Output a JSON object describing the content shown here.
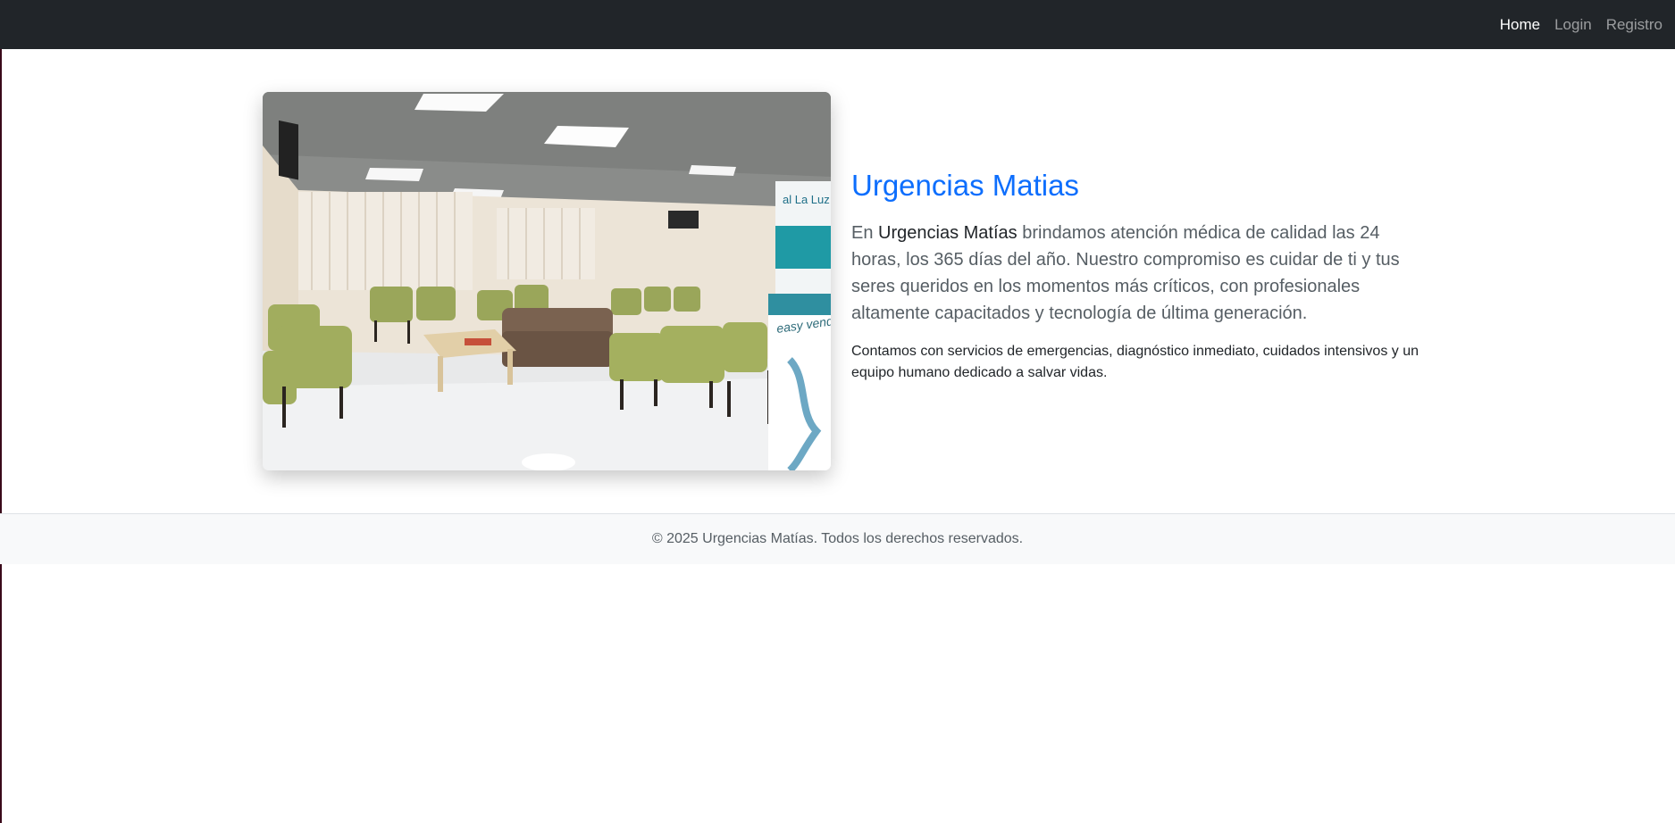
{
  "navbar": {
    "links": [
      {
        "label": "Home",
        "active": true
      },
      {
        "label": "Login",
        "active": false
      },
      {
        "label": "Registro",
        "active": false
      }
    ]
  },
  "hero": {
    "title": "Urgencias Matias",
    "lead_prefix": "En ",
    "lead_brand": "Urgencias Matías",
    "lead_suffix": " brindamos atención médica de calidad las 24 horas, los 365 días del año. Nuestro compromiso es cuidar de ti y tus seres queridos en los momentos más críticos, con profesionales altamente capacitados y tecnología de última generación.",
    "body": "Contamos con servicios de emergencias, diagnóstico inmediato, cuidados intensivos y un equipo humano dedicado a salvar vidas.",
    "image_banner_text": "al La Luz",
    "image_banner_sub": "easy vendi"
  },
  "footer": {
    "text": "© 2025 Urgencias Matías. Todos los derechos reservados."
  },
  "colors": {
    "navbar_bg": "#212529",
    "title_blue": "#0d6efd",
    "footer_bg": "#f8f9fa"
  }
}
